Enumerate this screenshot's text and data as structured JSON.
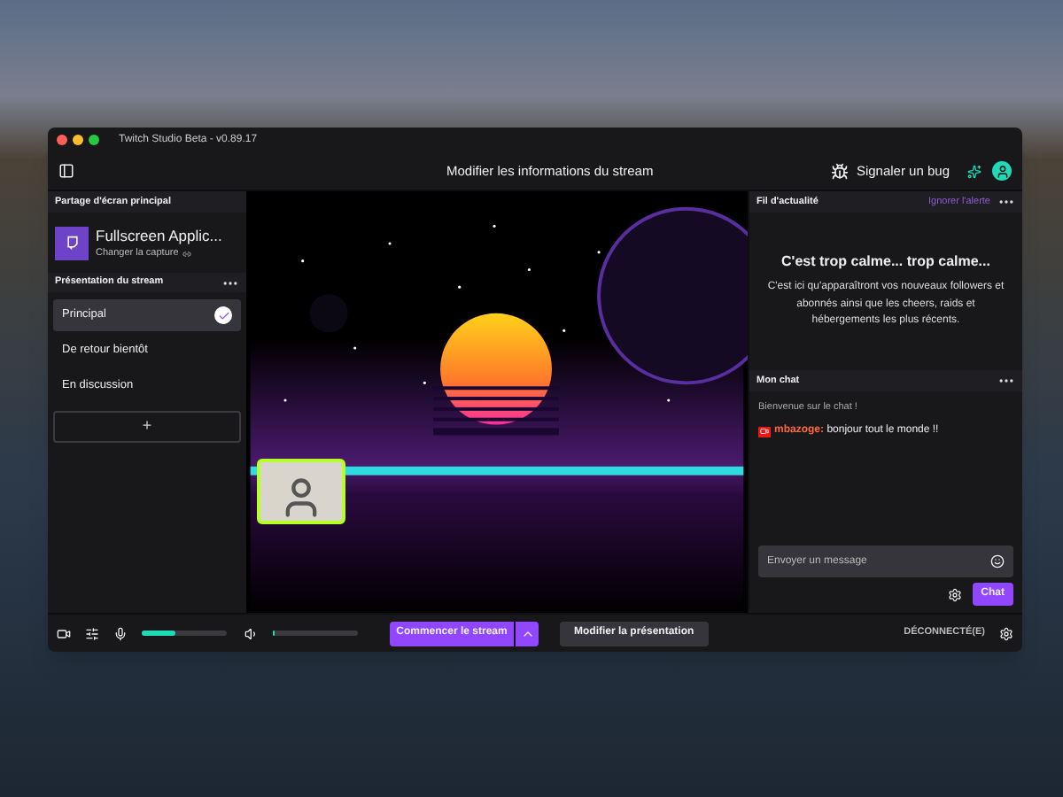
{
  "window": {
    "title": "Twitch Studio Beta - v0.89.17"
  },
  "header": {
    "title": "Modifier les informations du stream",
    "bug_button": "Signaler un bug"
  },
  "left_panel": {
    "capture_section": "Partage d'écran principal",
    "capture_name": "Fullscreen Applic...",
    "capture_link": "Changer la capture",
    "scenes_section": "Présentation du stream",
    "scenes": [
      {
        "label": "Principal",
        "selected": true
      },
      {
        "label": "De retour bientôt",
        "selected": false
      },
      {
        "label": "En discussion",
        "selected": false
      }
    ],
    "add_button": "+"
  },
  "feed": {
    "title": "Fil d'actualité",
    "dismiss": "Ignorer l'alerte",
    "heading": "C'est trop calme... trop calme...",
    "body": "C'est ici qu'apparaîtront vos nouveaux followers et abonnés ainsi que les cheers, raids et hébergements les plus récents."
  },
  "chat": {
    "title": "Mon chat",
    "welcome": "Bienvenue sur le chat !",
    "messages": [
      {
        "user": "mbazoge:",
        "text": "bonjour tout le monde !!"
      }
    ],
    "input": {
      "placeholder": "Envoyer un message"
    },
    "send_button": "Chat"
  },
  "bottom_bar": {
    "mic": {
      "level": 0.4
    },
    "volume": {
      "level": 0
    },
    "start_button": "Commencer le stream",
    "edit_button": "Modifier la présentation",
    "status": "DÉCONNECTÉ(E)"
  }
}
